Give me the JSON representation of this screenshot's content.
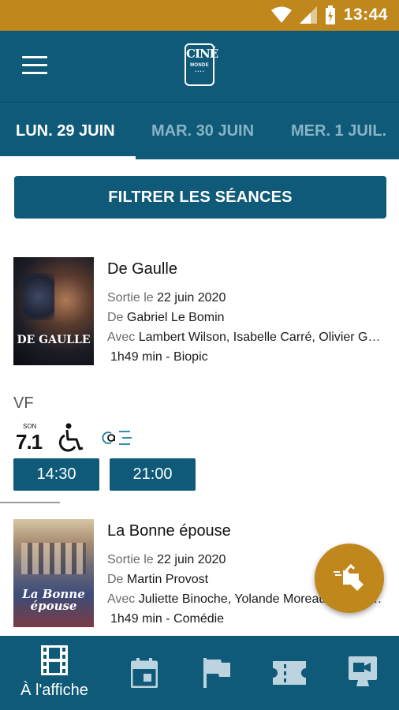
{
  "status": {
    "time": "13:44"
  },
  "header": {
    "menu_icon": "hamburger-menu-icon",
    "logo": {
      "main_top": "CINÉ",
      "sub": "MONDE",
      "dots": "• • • •"
    }
  },
  "date_tabs": [
    {
      "label": "LUN. 29 JUIN",
      "active": true
    },
    {
      "label": "MAR. 30 JUIN",
      "active": false
    },
    {
      "label": "MER. 1 JUIL.",
      "active": false
    }
  ],
  "filter_button": "FILTRER LES SÉANCES",
  "movies": [
    {
      "title": "De Gaulle",
      "poster_text": "DE GAULLE",
      "release_label": "Sortie le",
      "release_date": "22 juin 2020",
      "director_label": "De",
      "director": "Gabriel Le Bomin",
      "cast_label": "Avec",
      "cast": "Lambert Wilson, Isabelle Carré, Olivier Gourmet",
      "duration_genre": "1h49 min - Biopic",
      "version": "VF",
      "sound": {
        "label": "SON",
        "value": "7.1"
      },
      "features": [
        "sound-7-1-icon",
        "wheelchair-accessibility-icon",
        "audio-description-icon"
      ],
      "showtimes": [
        "14:30",
        "21:00"
      ]
    },
    {
      "title": "La Bonne épouse",
      "poster_text": "La Bonne épouse",
      "release_label": "Sortie le",
      "release_date": "22 juin 2020",
      "director_label": "De",
      "director": "Martin Provost",
      "cast_label": "Avec",
      "cast": "Juliette Binoche, Yolande Moreau, Noémie Lvovsky",
      "duration_genre": "1h49 min - Comédie"
    }
  ],
  "fab_icon": "ticket-arrow-icon",
  "bottom_nav": [
    {
      "icon": "film-icon",
      "label": "À l'affiche",
      "active": true
    },
    {
      "icon": "calendar-icon",
      "label": "",
      "active": false
    },
    {
      "icon": "flag-icon",
      "label": "",
      "active": false
    },
    {
      "icon": "ticket-icon",
      "label": "",
      "active": false
    },
    {
      "icon": "video-camera-icon",
      "label": "",
      "active": false
    }
  ],
  "colors": {
    "primary": "#0f5a78",
    "accent": "#c0871c",
    "tab_inactive": "#89b3c6"
  }
}
